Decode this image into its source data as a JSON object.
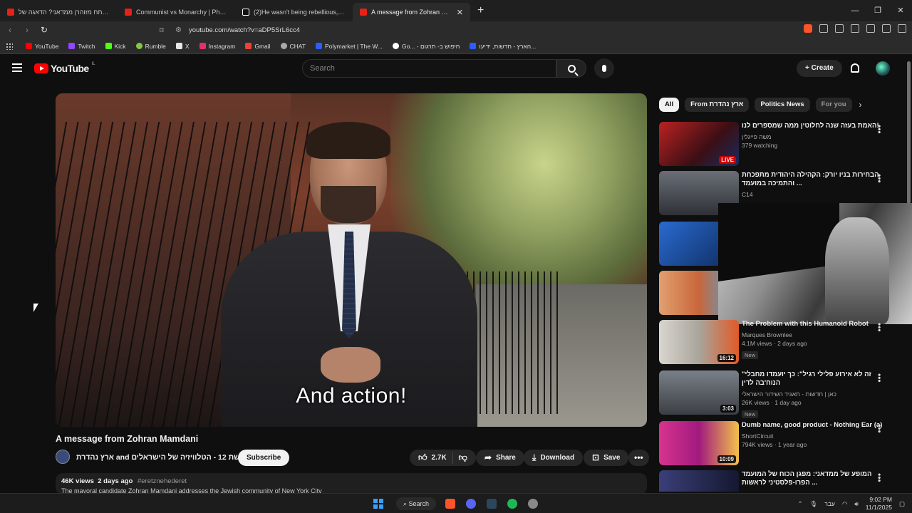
{
  "browser": {
    "tabs": [
      {
        "label": "סי מפתח מזוהרן ממדאני? הדאגה של",
        "icon": "youtube-icon"
      },
      {
        "label": "Communist vs Monarchy | Phonk Edit",
        "icon": "youtube-icon"
      },
      {
        "label": "(2)He wasn't being rebellious, he was",
        "icon": "tiktok-icon"
      },
      {
        "label": "A message from Zohran Mamdani",
        "icon": "youtube-icon",
        "active": true
      }
    ],
    "url": "youtube.com/watch?v=aDP5SrL6cc4",
    "bookmarks": [
      {
        "label": "YouTube",
        "color": "#ff0000"
      },
      {
        "label": "Twitch",
        "color": "#9146ff"
      },
      {
        "label": "Kick",
        "color": "#53fc18"
      },
      {
        "label": "Rumble",
        "color": "#85c742"
      },
      {
        "label": "X",
        "color": "#e7e7e7"
      },
      {
        "label": "Instagram",
        "color": "#e1306c"
      },
      {
        "label": "Gmail",
        "color": "#ea4335"
      },
      {
        "label": "CHAT",
        "color": "#aaaaaa"
      },
      {
        "label": "Polymarket | The W...",
        "color": "#2e5cff"
      },
      {
        "label": "Go... - חיפוש ב- תרגום",
        "color": "#ffffff"
      },
      {
        "label": "הארץ - חדשות, ידיעו...",
        "color": "#2e5cff"
      }
    ]
  },
  "yt": {
    "logo_text": "YouTube",
    "region": "IL",
    "search_placeholder": "Search",
    "create_label": "Create"
  },
  "video": {
    "caption": "And action!",
    "title": "A message from Zohran Mamdani",
    "channel": "ארץ נהדרת and קשת 12 - הטלוויזיה של הישראלים",
    "subscribe": "Subscribe",
    "likes": "2.7K",
    "share": "Share",
    "download": "Download",
    "save": "Save",
    "views": "46K views",
    "age": "2 days ago",
    "hashtag": "#eretznehederet",
    "desc_line": "The mayoral candidate Zohran Mamdani addresses the Jewish community of New York City"
  },
  "chips": [
    "All",
    "From ארץ נהדרת",
    "Politics News",
    "For you"
  ],
  "suggestions": [
    {
      "title": "האמת בעזה שנה לחלוטין ממה שמספרים לנו!",
      "channel": "משה פייגלין",
      "meta": "379 watching",
      "badge": "LIVE",
      "thumb": "#8a1d1d"
    },
    {
      "title": "הבחירות בניו יורק: הקהילה היהודית מתפכחת והתמיכה במועמד ...",
      "channel": "C14",
      "meta": "",
      "badge": "",
      "thumb": "#4a4e56"
    },
    {
      "title": "",
      "channel": "",
      "meta": "",
      "badge": "",
      "thumb": "#1e4fa0"
    },
    {
      "title": "",
      "channel": "",
      "meta": "",
      "badge": "",
      "thumb": "#d8884a"
    },
    {
      "title": "The Problem with this Humanoid Robot",
      "channel": "Marques Brownlee",
      "meta": "4.1M views · 2 days ago",
      "badge": "New",
      "dur": "16:12",
      "thumb": "#b5b0a6"
    },
    {
      "title": "\"זה לא אירוע פלילי רגיל\": כך יועמדו מחבלי הנוח'בה לדין",
      "channel": "כאן | חדשות - תאגיד השידור הישראלי",
      "meta": "26K views · 1 day ago",
      "badge": "New",
      "dur": "3:03",
      "thumb": "#5a5f66"
    },
    {
      "title": "Dumb name, good product - Nothing Ear (a)",
      "channel": "ShortCircuit",
      "meta": "794K views · 1 year ago",
      "badge": "",
      "dur": "10:09",
      "thumb": "#b52a9a"
    },
    {
      "title": "המופע של ממדאני: מפגן הכוח של המועמד הפרו-פלסטיני לראשות ...",
      "channel": "",
      "meta": "",
      "badge": "",
      "thumb": "#3a3f78"
    }
  ],
  "taskbar": {
    "search": "Search",
    "lang": "עבר",
    "time": "9:02 PM",
    "date": "11/1/2025"
  }
}
